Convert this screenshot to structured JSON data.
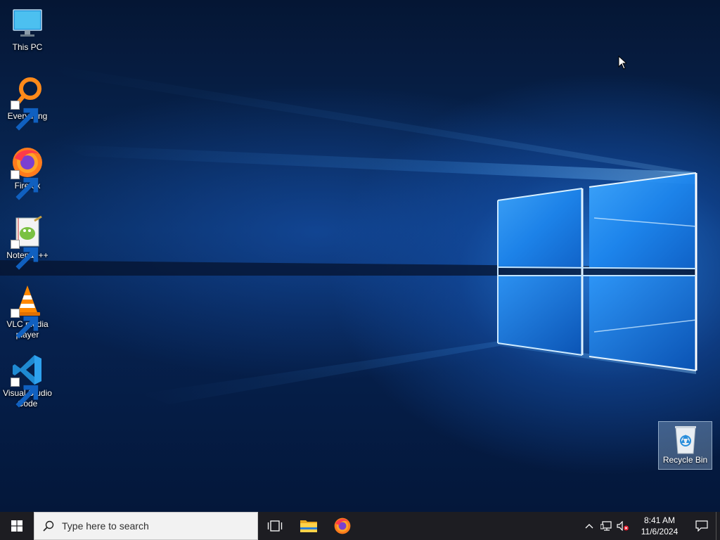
{
  "desktop": {
    "icons": [
      {
        "label": "This PC",
        "icon": "monitor-icon"
      },
      {
        "label": "Everything",
        "icon": "everything-search-icon"
      },
      {
        "label": "Firefox",
        "icon": "firefox-icon"
      },
      {
        "label": "Notepad++",
        "icon": "notepad-plus-plus-icon"
      },
      {
        "label": "VLC media player",
        "icon": "vlc-cone-icon"
      },
      {
        "label": "Visual Studio Code",
        "icon": "vscode-icon"
      }
    ],
    "recycle_bin": {
      "label": "Recycle Bin",
      "icon": "recycle-bin-icon",
      "selected": true
    }
  },
  "taskbar": {
    "search": {
      "placeholder": "Type here to search"
    },
    "pinned": [
      {
        "icon": "task-view-icon"
      },
      {
        "icon": "file-explorer-icon"
      },
      {
        "icon": "firefox-icon"
      }
    ],
    "tray": {
      "icons": [
        "chevron-up-icon",
        "network-icon",
        "volume-muted-icon"
      ],
      "time": "8:41 AM",
      "date": "11/6/2024"
    }
  },
  "colors": {
    "accent": "#0078d7",
    "taskbar_bg": "#1d1d22",
    "search_bg": "#f2f2f2"
  }
}
